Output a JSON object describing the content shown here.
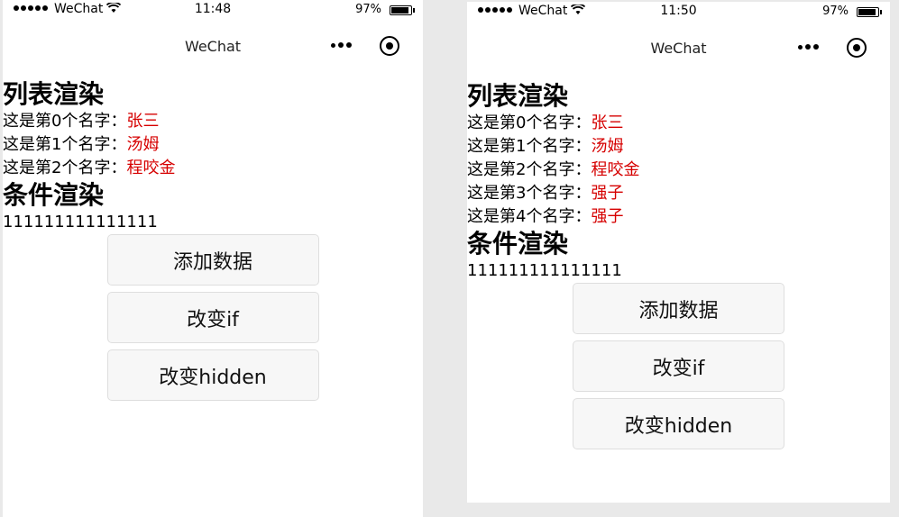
{
  "screens": [
    {
      "status": {
        "carrier": "WeChat",
        "time": "11:48",
        "battery_pct": "97%"
      },
      "nav": {
        "title": "WeChat"
      },
      "list_title": "列表渲染",
      "items": [
        {
          "prefix": "这是第0个名字：",
          "name": "张三"
        },
        {
          "prefix": "这是第1个名字：",
          "name": "汤姆"
        },
        {
          "prefix": "这是第2个名字：",
          "name": "程咬金"
        }
      ],
      "cond_title": "条件渲染",
      "cond_text": "111111111111111",
      "buttons": {
        "add": "添加数据",
        "change_if": "改变if",
        "change_hidden": "改变hidden"
      }
    },
    {
      "status": {
        "carrier": "WeChat",
        "time": "11:50",
        "battery_pct": "97%"
      },
      "nav": {
        "title": "WeChat"
      },
      "list_title": "列表渲染",
      "items": [
        {
          "prefix": "这是第0个名字：",
          "name": "张三"
        },
        {
          "prefix": "这是第1个名字：",
          "name": "汤姆"
        },
        {
          "prefix": "这是第2个名字：",
          "name": "程咬金"
        },
        {
          "prefix": "这是第3个名字：",
          "name": "强子"
        },
        {
          "prefix": "这是第4个名字：",
          "name": "强子"
        }
      ],
      "cond_title": "条件渲染",
      "cond_text": "111111111111111",
      "buttons": {
        "add": "添加数据",
        "change_if": "改变if",
        "change_hidden": "改变hidden"
      }
    }
  ],
  "colors": {
    "name_text": "#d60000",
    "button_bg": "#f7f7f7",
    "button_border": "#dedede"
  },
  "icons": {
    "signal": "signal-dots-icon",
    "wifi": "wifi-icon",
    "battery": "battery-icon",
    "menu": "more-dots-icon",
    "close": "capsule-close-icon"
  }
}
